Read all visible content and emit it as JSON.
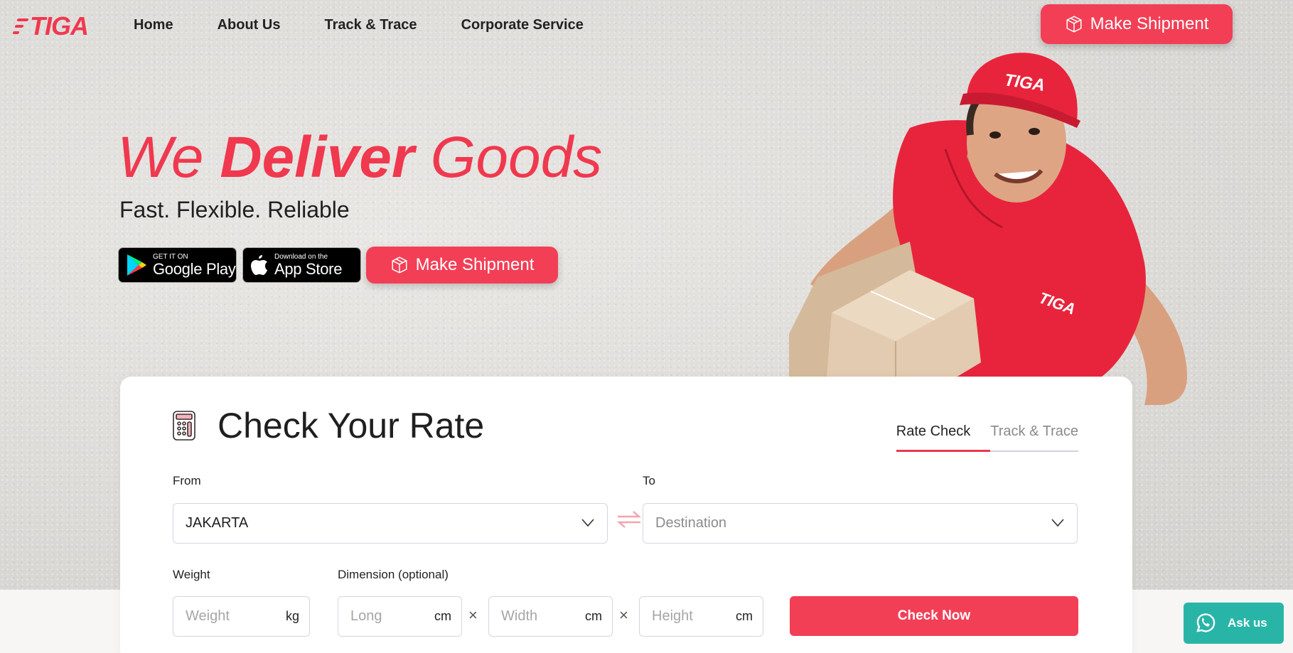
{
  "brand": {
    "logo_text": "TIGA",
    "accent": "#f23f56"
  },
  "nav": {
    "links": [
      "Home",
      "About Us",
      "Track & Trace",
      "Corporate Service"
    ],
    "cta": "Make Shipment"
  },
  "hero": {
    "headline_part1": "We ",
    "headline_bold": "Deliver",
    "headline_part2": " Goods",
    "subline": "Fast. Flexible. Reliable",
    "google_play": {
      "small": "GET IT ON",
      "big": "Google Play"
    },
    "app_store": {
      "small": "Download on the",
      "big": "App Store"
    },
    "cta": "Make Shipment"
  },
  "rate": {
    "title": "Check Your Rate",
    "tabs": [
      "Rate Check",
      "Track & Trace"
    ],
    "from_label": "From",
    "from_value": "JAKARTA",
    "to_label": "To",
    "to_placeholder": "Destination",
    "weight_label": "Weight",
    "weight_placeholder": "Weight",
    "weight_unit": "kg",
    "dimension_label": "Dimension (optional)",
    "long_placeholder": "Long",
    "width_placeholder": "Width",
    "height_placeholder": "Height",
    "dim_unit": "cm",
    "times": "×",
    "check_button": "Check Now"
  },
  "whatsapp": {
    "label": "Ask us"
  }
}
